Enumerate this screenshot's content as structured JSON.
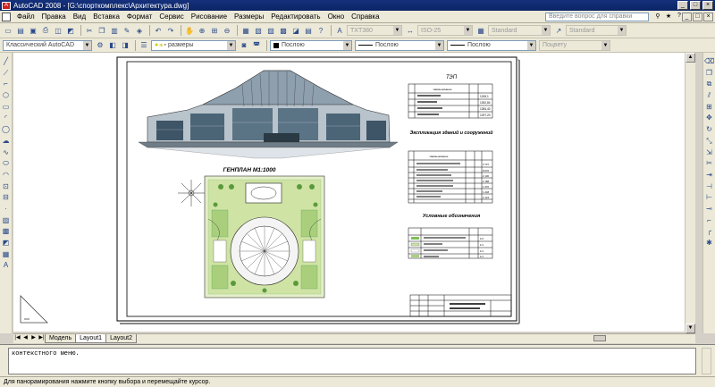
{
  "window": {
    "title": "AutoCAD 2008 - [G:\\спорткомплекс\\Архитектура.dwg]",
    "app_icon": "A",
    "controls": [
      "_",
      "□",
      "×"
    ]
  },
  "menu": {
    "items": [
      "Файл",
      "Правка",
      "Вид",
      "Вставка",
      "Формат",
      "Сервис",
      "Рисование",
      "Размеры",
      "Редактировать",
      "Окно",
      "Справка"
    ],
    "help_placeholder": "Введите вопрос для справки",
    "mdi_controls": [
      "_",
      "□",
      "×"
    ]
  },
  "toolbar1": {
    "text_style": "TXT380",
    "dim_style": "ISO-25",
    "table_style": "Standard",
    "mleader_style": "Standard"
  },
  "toolbar2": {
    "workspace": "Классический AutoCAD",
    "layer": "размеры",
    "color": "Послою",
    "linetype": "Послою",
    "lineweight": "Послою",
    "plotstyle": "Поцвету"
  },
  "drawing": {
    "tep_title": "ТЭП",
    "explication_title": "Экспликация зданий и сооружений",
    "legend_title": "Условные обозначения",
    "genplan_title": "ГЕНПЛАН М1:1000",
    "col_name": "Наименование",
    "tep_values": [
      "1245,1",
      "1262,84",
      "1284,40",
      "1297,20"
    ],
    "expl_values": [
      "3 737",
      "8 670",
      "2 130",
      "2 188",
      "1 370",
      "1 248",
      "2 124"
    ],
    "legend_values": [
      "1/2",
      "1/1",
      "1/1",
      "1/1"
    ]
  },
  "tabs": {
    "nav": [
      "|◀",
      "◀",
      "▶",
      "▶|"
    ],
    "items": [
      "Модель",
      "Layout1",
      "Layout2"
    ],
    "active": "Layout1"
  },
  "command": {
    "history": "контекстного меню."
  },
  "status": {
    "message": "Для панорамирования нажмите кнопку выбора и перемещайте курсор."
  }
}
